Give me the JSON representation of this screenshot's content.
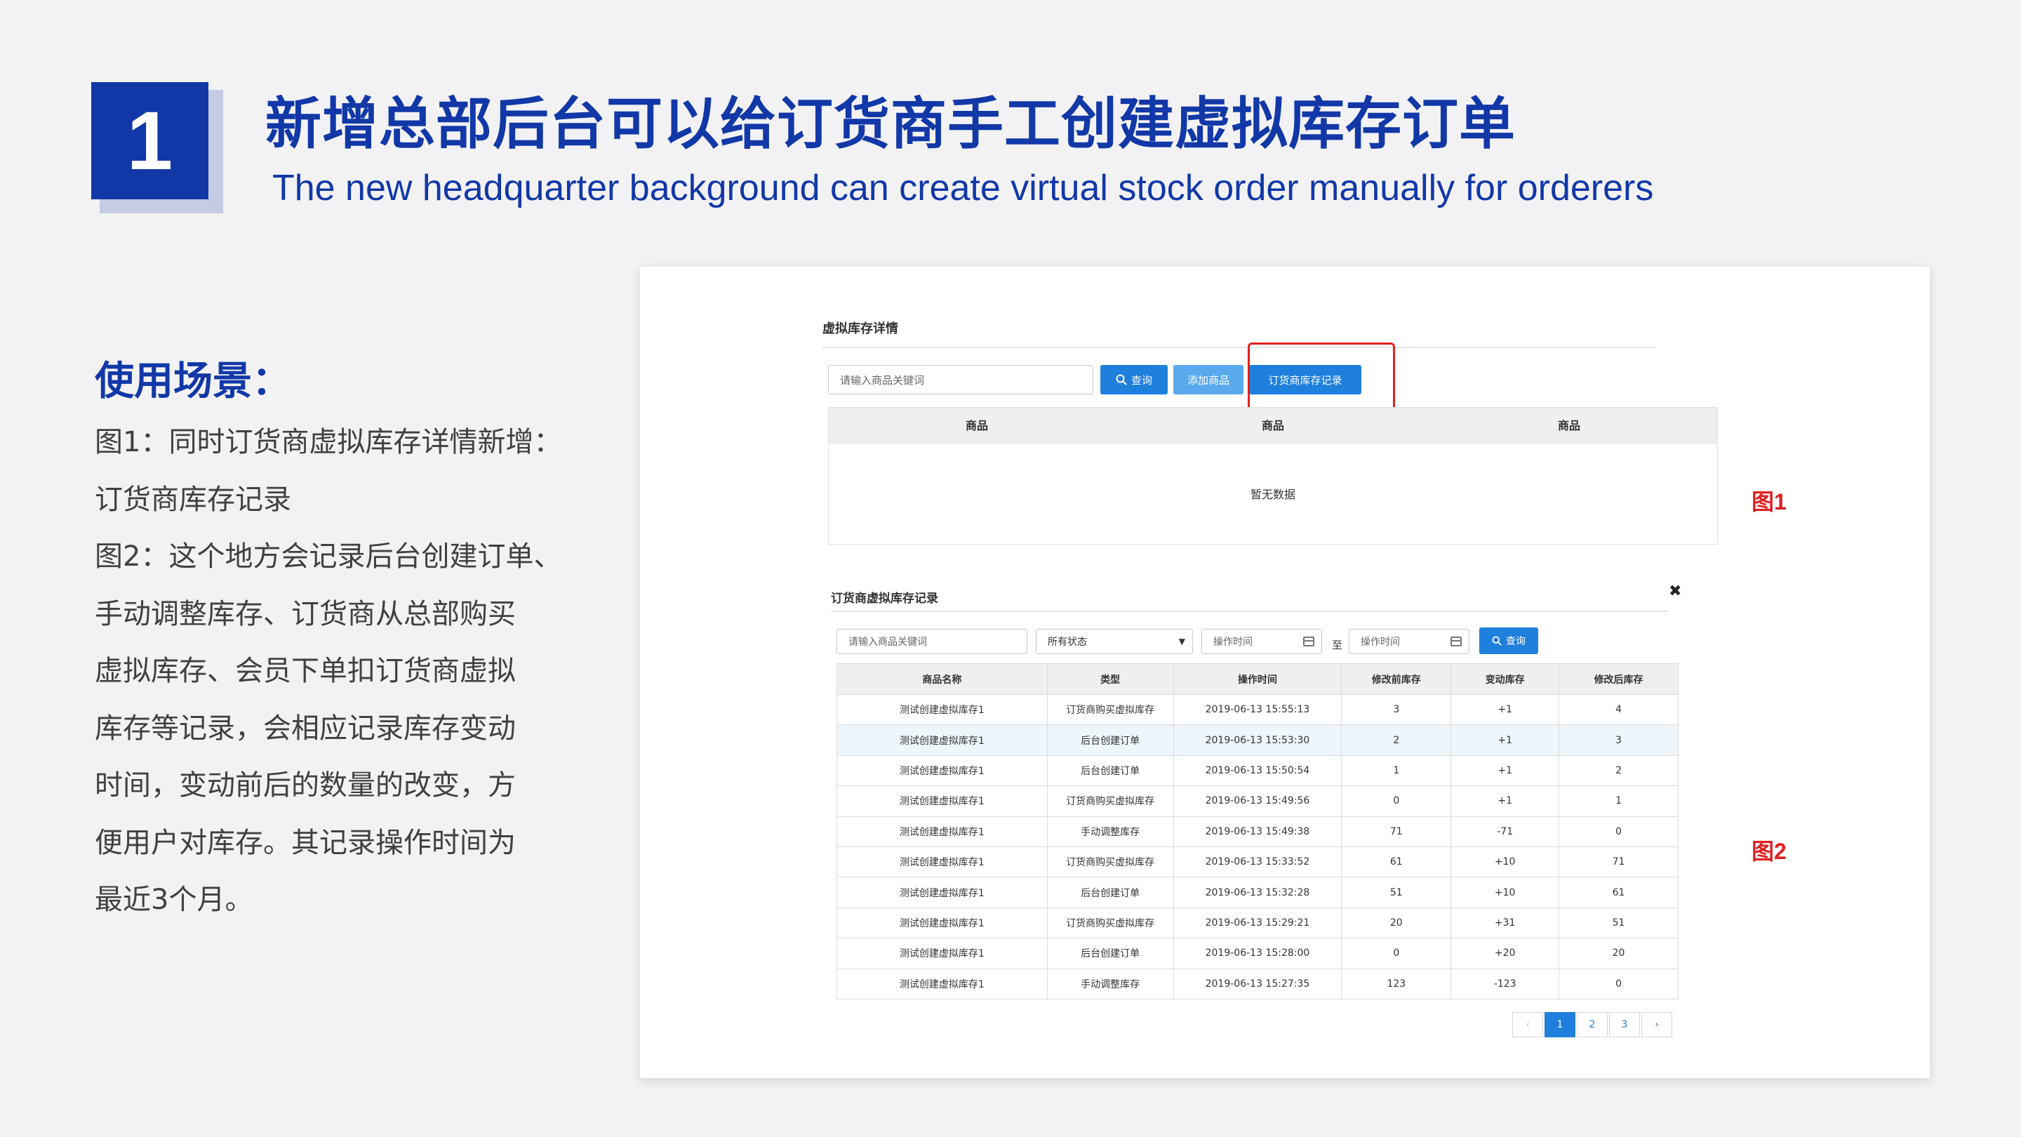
{
  "slide": {
    "number": "1",
    "title_cn": "新增总部后台可以给订货商手工创建虚拟库存订单",
    "title_en": "The new headquarter background can create virtual stock order manually for orderers",
    "usage_title": "使用场景：",
    "usage_lines": [
      "图1：同时订货商虚拟库存详情新增：",
      "订货商库存记录",
      "图2：这个地方会记录后台创建订单、",
      "手动调整库存、订货商从总部购买",
      "虚拟库存、会员下单扣订货商虚拟",
      "库存等记录，会相应记录库存变动",
      "时间，变动前后的数量的改变，方",
      "便用户对库存。其记录操作时间为",
      "最近3个月。"
    ],
    "fig1_label": "图1",
    "fig2_label": "图2"
  },
  "panel1": {
    "title": "虚拟库存详情",
    "search_placeholder": "请输入商品关键词",
    "query_button": "查询",
    "add_button": "添加商品",
    "record_button": "订货商库存记录",
    "columns": [
      "商品",
      "商品",
      "商品"
    ],
    "empty_text": "暂无数据"
  },
  "panel2": {
    "title": "订货商虚拟库存记录",
    "close": "✖",
    "search_placeholder": "请输入商品关键词",
    "status_select": "所有状态",
    "date_from_placeholder": "操作时间",
    "to_label": "至",
    "date_to_placeholder": "操作时间",
    "query_button": "查询",
    "columns": [
      "商品名称",
      "类型",
      "操作时间",
      "修改前库存",
      "变动库存",
      "修改后库存"
    ],
    "rows": [
      [
        "测试创建虚拟库存1",
        "订货商购买虚拟库存",
        "2019-06-13 15:55:13",
        "3",
        "+1",
        "4"
      ],
      [
        "测试创建虚拟库存1",
        "后台创建订单",
        "2019-06-13 15:53:30",
        "2",
        "+1",
        "3"
      ],
      [
        "测试创建虚拟库存1",
        "后台创建订单",
        "2019-06-13 15:50:54",
        "1",
        "+1",
        "2"
      ],
      [
        "测试创建虚拟库存1",
        "订货商购买虚拟库存",
        "2019-06-13 15:49:56",
        "0",
        "+1",
        "1"
      ],
      [
        "测试创建虚拟库存1",
        "手动调整库存",
        "2019-06-13 15:49:38",
        "71",
        "-71",
        "0"
      ],
      [
        "测试创建虚拟库存1",
        "订货商购买虚拟库存",
        "2019-06-13 15:33:52",
        "61",
        "+10",
        "71"
      ],
      [
        "测试创建虚拟库存1",
        "后台创建订单",
        "2019-06-13 15:32:28",
        "51",
        "+10",
        "61"
      ],
      [
        "测试创建虚拟库存1",
        "订货商购买虚拟库存",
        "2019-06-13 15:29:21",
        "20",
        "+31",
        "51"
      ],
      [
        "测试创建虚拟库存1",
        "后台创建订单",
        "2019-06-13 15:28:00",
        "0",
        "+20",
        "20"
      ],
      [
        "测试创建虚拟库存1",
        "手动调整库存",
        "2019-06-13 15:27:35",
        "123",
        "-123",
        "0"
      ]
    ],
    "pager": {
      "prev": "‹",
      "pages": [
        "1",
        "2",
        "3"
      ],
      "next": "›",
      "current": "1"
    }
  },
  "colors": {
    "brand_blue": "#1238a8",
    "button_blue": "#1f7fdc",
    "highlight_red": "#e02020"
  }
}
